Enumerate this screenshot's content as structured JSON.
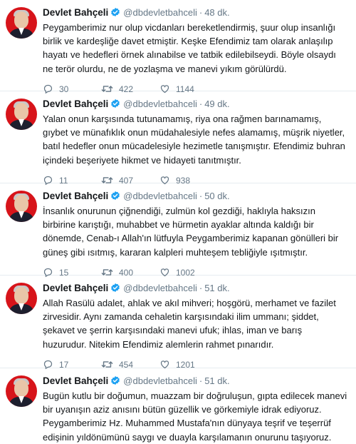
{
  "tweets": [
    {
      "name": "Devlet Bahçeli",
      "handle": "@dbdevletbahceli",
      "time": "48 dk.",
      "text": "Peygamberimiz nur olup vicdanları bereketlendirmiş, şuur olup insanlığı birlik ve kardeşliğe davet etmiştir. Keşke Efendimiz tam olarak anlaşılıp hayatı ve hedefleri örnek alınabilse ve tatbik edilebilseydi. Böyle olsaydı ne terör olurdu, ne de yozlaşma ve manevi yıkım görülürdü.",
      "replies": "30",
      "retweets": "422",
      "likes": "1144"
    },
    {
      "name": "Devlet Bahçeli",
      "handle": "@dbdevletbahceli",
      "time": "49 dk.",
      "text": "Yalan onun karşısında tutunamamış, riya ona rağmen barınamamış, gıybet ve münafıklık onun müdahalesiyle nefes alamamış, müşrik niyetler, batıl hedefler onun mücadelesiyle hezimetle tanışmıştır. Efendimiz buhran içindeki beşeriyete hikmet ve hidayeti tanıtmıştır.",
      "replies": "11",
      "retweets": "407",
      "likes": "938"
    },
    {
      "name": "Devlet Bahçeli",
      "handle": "@dbdevletbahceli",
      "time": "50 dk.",
      "text": "İnsanlık onurunun çiğnendiği, zulmün kol gezdiği, haklıyla haksızın birbirine karıştığı, muhabbet ve hürmetin ayaklar altında kaldığı bir dönemde, Cenab-ı Allah'ın lütfuyla Peygamberimiz kapanan gönülleri bir güneş gibi ısıtmış, kararan kalpleri muhteşem tebliğiyle ışıtmıştır.",
      "replies": "15",
      "retweets": "400",
      "likes": "1002"
    },
    {
      "name": "Devlet Bahçeli",
      "handle": "@dbdevletbahceli",
      "time": "51 dk.",
      "text": "Allah Rasülü adalet, ahlak ve akıl mihveri; hoşgörü, merhamet ve fazilet zirvesidir. Aynı zamanda cehaletin karşısındaki ilim ummanı; şiddet, şekavet ve şerrin karşısındaki manevi ufuk; ihlas, iman ve barış huzurudur. Nitekim Efendimiz alemlerin rahmet pınarıdır.",
      "replies": "17",
      "retweets": "454",
      "likes": "1201"
    },
    {
      "name": "Devlet Bahçeli",
      "handle": "@dbdevletbahceli",
      "time": "51 dk.",
      "text": "Bugün kutlu bir doğumun, muazzam bir doğruluşun, gıpta edilecek manevi bir uyanışın aziz anısını bütün güzellik ve görkemiyle idrak ediyoruz. Peygamberimiz Hz. Muhammed Mustafa'nın dünyaya teşrif ve teşerrüf edişinin yıldönümünü saygı ve duayla karşılamanın onurunu taşıyoruz."
    }
  ],
  "colors": {
    "text": "#14171a",
    "muted": "#657786",
    "verified": "#1da1f2",
    "divider": "#e6ecf0",
    "avatar_bg": "#d7141a"
  },
  "icons": {
    "reply": "reply-icon",
    "retweet": "retweet-icon",
    "like": "like-icon",
    "verified": "verified-badge-icon"
  }
}
